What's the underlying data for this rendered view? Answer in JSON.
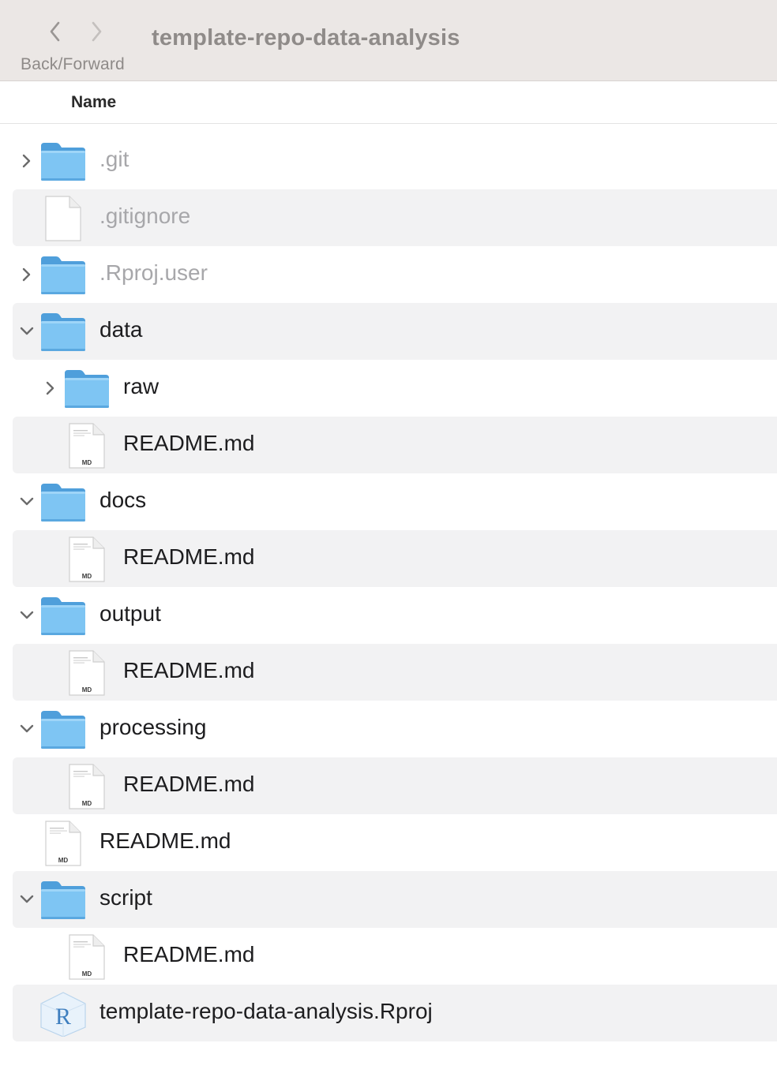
{
  "window": {
    "title": "template-repo-data-analysis",
    "nav_label": "Back/Forward"
  },
  "columns": {
    "name": "Name"
  },
  "colors": {
    "titlebar": "#ebe7e5",
    "folder_blue": "#7ec5f3",
    "row_alt": "#f2f2f3",
    "hidden_text": "#a7a7aa"
  },
  "rows": [
    {
      "label": ".git",
      "type": "folder",
      "depth": 0,
      "disclosure": "collapsed",
      "hidden": true
    },
    {
      "label": ".gitignore",
      "type": "file",
      "depth": 0,
      "disclosure": "none",
      "hidden": true
    },
    {
      "label": ".Rproj.user",
      "type": "folder",
      "depth": 0,
      "disclosure": "collapsed",
      "hidden": true
    },
    {
      "label": "data",
      "type": "folder",
      "depth": 0,
      "disclosure": "expanded",
      "hidden": false
    },
    {
      "label": "raw",
      "type": "folder",
      "depth": 1,
      "disclosure": "collapsed",
      "hidden": false
    },
    {
      "label": "README.md",
      "type": "md",
      "depth": 1,
      "disclosure": "none",
      "hidden": false,
      "badge": "MD"
    },
    {
      "label": "docs",
      "type": "folder",
      "depth": 0,
      "disclosure": "expanded",
      "hidden": false
    },
    {
      "label": "README.md",
      "type": "md",
      "depth": 1,
      "disclosure": "none",
      "hidden": false,
      "badge": "MD"
    },
    {
      "label": "output",
      "type": "folder",
      "depth": 0,
      "disclosure": "expanded",
      "hidden": false
    },
    {
      "label": "README.md",
      "type": "md",
      "depth": 1,
      "disclosure": "none",
      "hidden": false,
      "badge": "MD"
    },
    {
      "label": "processing",
      "type": "folder",
      "depth": 0,
      "disclosure": "expanded",
      "hidden": false
    },
    {
      "label": "README.md",
      "type": "md",
      "depth": 1,
      "disclosure": "none",
      "hidden": false,
      "badge": "MD"
    },
    {
      "label": "README.md",
      "type": "md",
      "depth": 0,
      "disclosure": "none",
      "hidden": false,
      "badge": "MD"
    },
    {
      "label": "script",
      "type": "folder",
      "depth": 0,
      "disclosure": "expanded",
      "hidden": false
    },
    {
      "label": "README.md",
      "type": "md",
      "depth": 1,
      "disclosure": "none",
      "hidden": false,
      "badge": "MD"
    },
    {
      "label": "template-repo-data-analysis.Rproj",
      "type": "rproj",
      "depth": 0,
      "disclosure": "none",
      "hidden": false,
      "badge": "R"
    }
  ]
}
